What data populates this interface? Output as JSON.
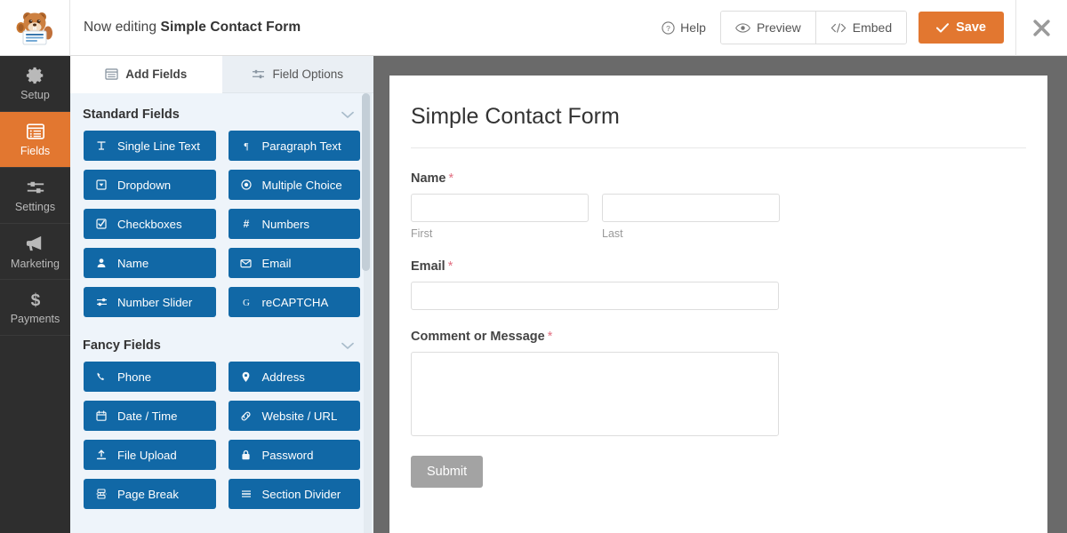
{
  "topbar": {
    "editing_prefix": "Now editing",
    "form_name": "Simple Contact Form",
    "help_label": "Help",
    "preview_label": "Preview",
    "embed_label": "Embed",
    "save_label": "Save",
    "save_color": "#e27730",
    "logo_name": "wpforms-beaver-logo"
  },
  "rail": {
    "items": [
      {
        "label": "Setup",
        "icon": "gear-icon",
        "active": false
      },
      {
        "label": "Fields",
        "icon": "list-icon",
        "active": true
      },
      {
        "label": "Settings",
        "icon": "sliders-icon",
        "active": false
      },
      {
        "label": "Marketing",
        "icon": "megaphone-icon",
        "active": false
      },
      {
        "label": "Payments",
        "icon": "dollar-icon",
        "active": false
      }
    ],
    "active_color": "#e27730",
    "bg_color": "#2e2e2e"
  },
  "panel": {
    "tabs": [
      {
        "label": "Add Fields",
        "icon": "fields-icon",
        "active": true
      },
      {
        "label": "Field Options",
        "icon": "options-icon",
        "active": false
      }
    ],
    "sections": [
      {
        "title": "Standard Fields",
        "collapsed": false,
        "fields": [
          {
            "label": "Single Line Text",
            "icon": "text-cursor-icon"
          },
          {
            "label": "Paragraph Text",
            "icon": "pilcrow-icon"
          },
          {
            "label": "Dropdown",
            "icon": "caret-square-icon"
          },
          {
            "label": "Multiple Choice",
            "icon": "radio-icon"
          },
          {
            "label": "Checkboxes",
            "icon": "checkbox-icon"
          },
          {
            "label": "Numbers",
            "icon": "hash-icon"
          },
          {
            "label": "Name",
            "icon": "user-icon"
          },
          {
            "label": "Email",
            "icon": "envelope-icon"
          },
          {
            "label": "Number Slider",
            "icon": "slider-icon"
          },
          {
            "label": "reCAPTCHA",
            "icon": "google-g-icon"
          }
        ]
      },
      {
        "title": "Fancy Fields",
        "collapsed": false,
        "fields": [
          {
            "label": "Phone",
            "icon": "phone-icon"
          },
          {
            "label": "Address",
            "icon": "map-pin-icon"
          },
          {
            "label": "Date / Time",
            "icon": "calendar-icon"
          },
          {
            "label": "Website / URL",
            "icon": "link-icon"
          },
          {
            "label": "File Upload",
            "icon": "upload-icon"
          },
          {
            "label": "Password",
            "icon": "lock-icon"
          },
          {
            "label": "Page Break",
            "icon": "page-break-icon"
          },
          {
            "label": "Section Divider",
            "icon": "divider-icon"
          }
        ]
      }
    ],
    "button_color": "#1168a6"
  },
  "preview": {
    "form_title": "Simple Contact Form",
    "required_marker": "*",
    "fields": [
      {
        "label": "Name",
        "required": true,
        "type": "name",
        "subfields": [
          {
            "sublabel": "First",
            "value": ""
          },
          {
            "sublabel": "Last",
            "value": ""
          }
        ]
      },
      {
        "label": "Email",
        "required": true,
        "type": "text",
        "value": ""
      },
      {
        "label": "Comment or Message",
        "required": true,
        "type": "textarea",
        "value": ""
      }
    ],
    "submit_label": "Submit"
  }
}
